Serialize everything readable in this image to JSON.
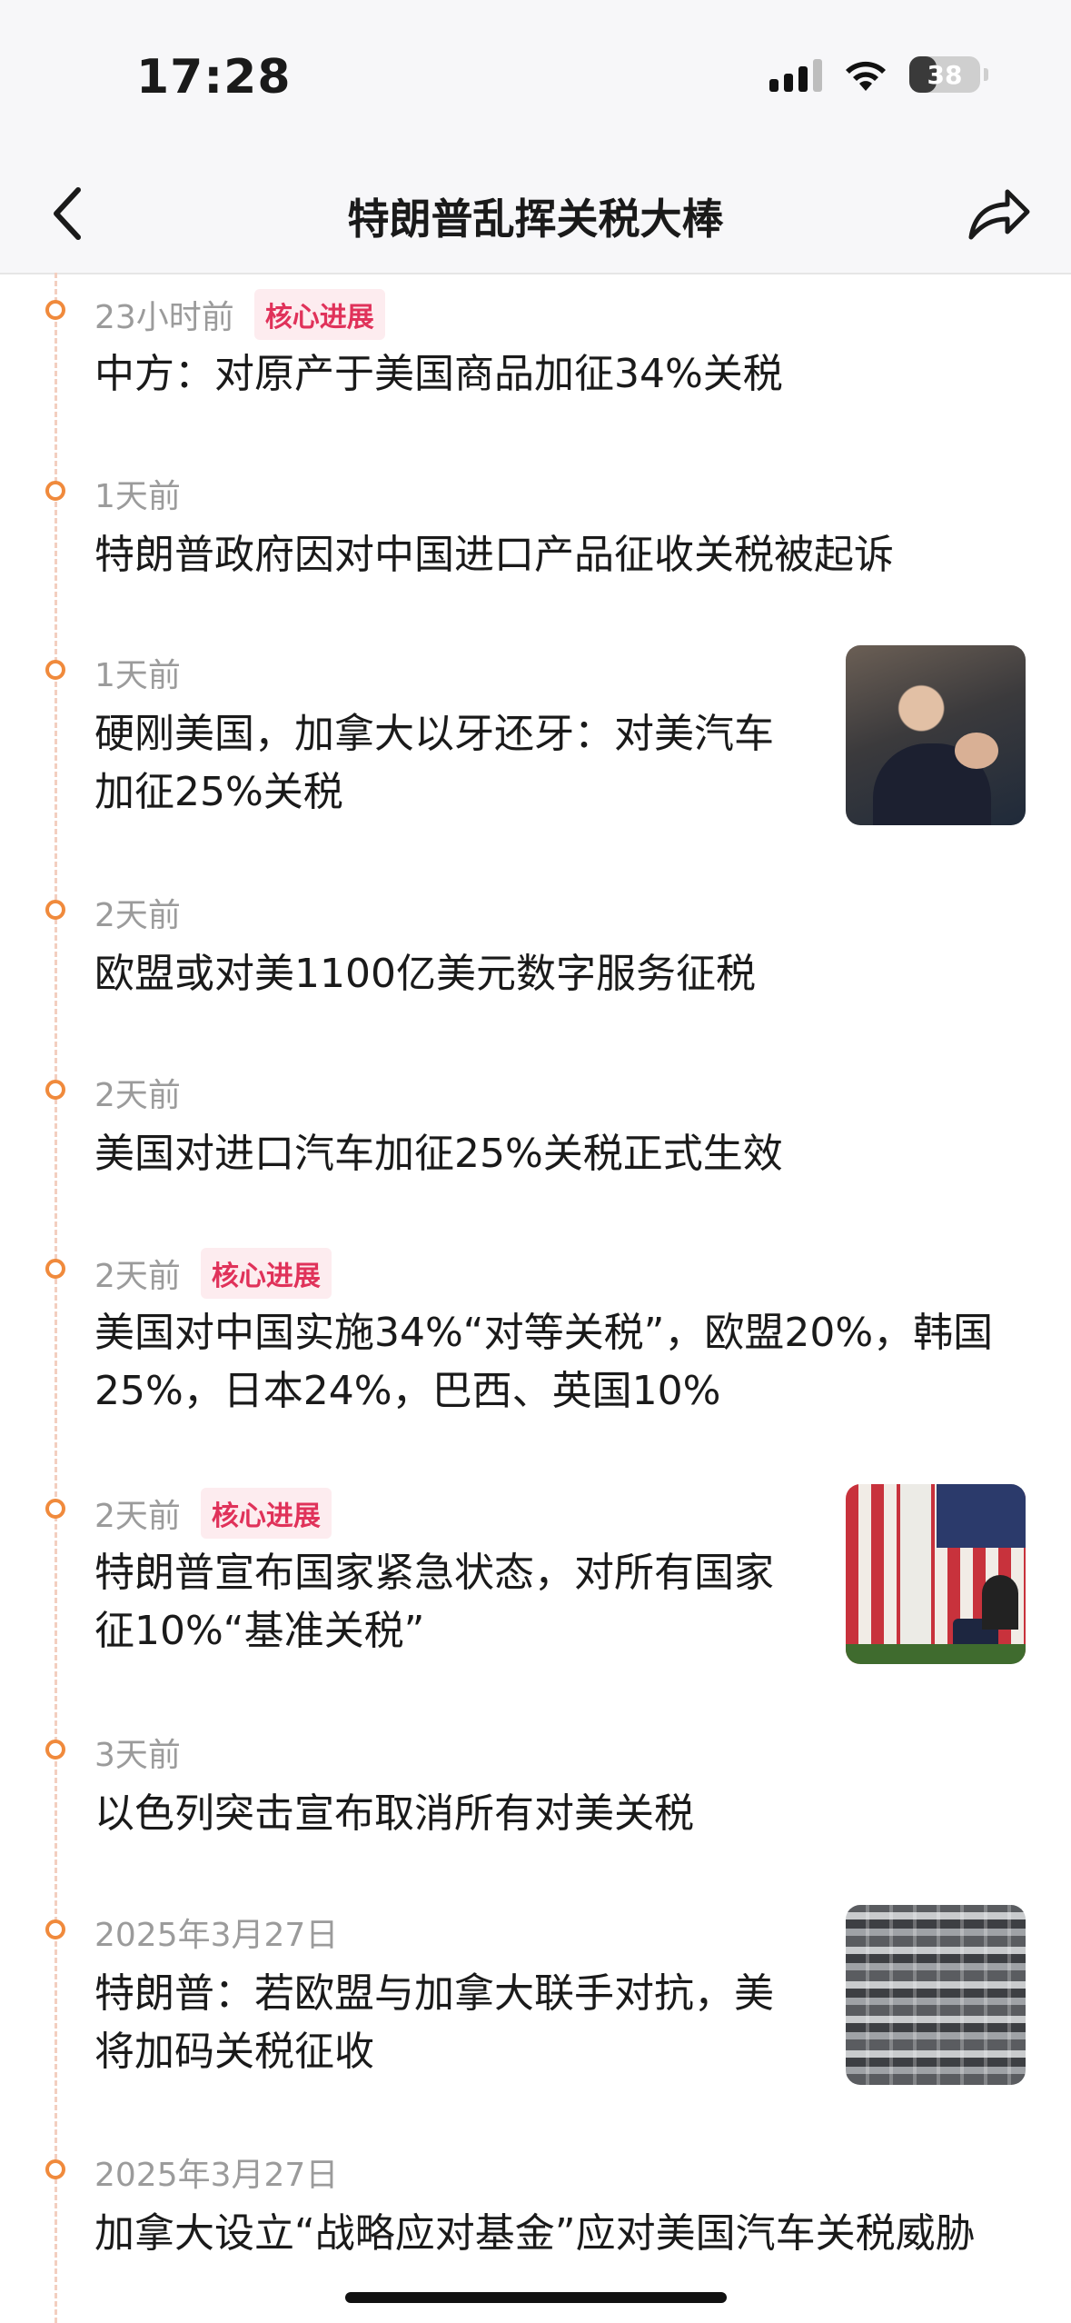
{
  "status_bar": {
    "time": "17:28",
    "battery": "38"
  },
  "header": {
    "title": "特朗普乱挥关税大棒"
  },
  "timeline": [
    {
      "time": "23小时前",
      "badge": "核心进展",
      "headline": "中方：对原产于美国商品加征34%关税"
    },
    {
      "time": "1天前",
      "badge": "",
      "headline": "特朗普政府因对中国进口产品征收关税被起诉"
    },
    {
      "time": "1天前",
      "badge": "",
      "headline": "硬刚美国，加拿大以牙还牙：对美汽车加征25%关税",
      "image": "speaker-photo"
    },
    {
      "time": "2天前",
      "badge": "",
      "headline": "欧盟或对美1100亿美元数字服务征税"
    },
    {
      "time": "2天前",
      "badge": "",
      "headline": "美国对进口汽车加征25%关税正式生效"
    },
    {
      "time": "2天前",
      "badge": "核心进展",
      "headline": "美国对中国实施34%“对等关税”，欧盟20%，韩国25%，日本24%，巴西、英国10%"
    },
    {
      "time": "2天前",
      "badge": "核心进展",
      "headline": "特朗普宣布国家紧急状态，对所有国家征10%“基准关税”",
      "image": "flag-podium-photo"
    },
    {
      "time": "3天前",
      "badge": "",
      "headline": "以色列突击宣布取消所有对美关税"
    },
    {
      "time": "2025年3月27日",
      "badge": "",
      "headline": "特朗普：若欧盟与加拿大联手对抗，美将加码关税征收",
      "image": "car-lot-photo"
    },
    {
      "time": "2025年3月27日",
      "badge": "",
      "headline": "加拿大设立“战略应对基金”应对美国汽车关税威胁"
    }
  ]
}
